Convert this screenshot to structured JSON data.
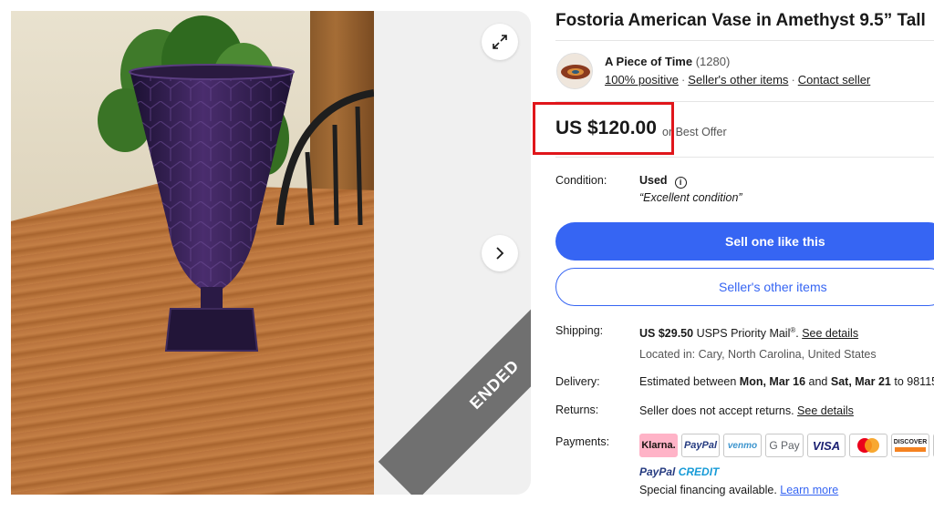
{
  "listing": {
    "title": "Fostoria American Vase in Amethyst 9.5” Tall",
    "ended_label": "ENDED"
  },
  "seller": {
    "name": "A Piece of Time",
    "feedback_count": "(1280)",
    "positive": "100% positive",
    "other_items": "Seller's other items",
    "contact": "Contact seller"
  },
  "price": {
    "amount": "US $120.00",
    "best_offer": "or Best Offer"
  },
  "condition": {
    "label": "Condition:",
    "value": "Used",
    "quote": "“Excellent condition”"
  },
  "buttons": {
    "sell_one": "Sell one like this",
    "other_items": "Seller's other items"
  },
  "shipping": {
    "label": "Shipping:",
    "price": "US $29.50",
    "service": "USPS Priority Mail",
    "registered": "®",
    "details_link": "See details",
    "location": "Located in: Cary, North Carolina, United States"
  },
  "delivery": {
    "label": "Delivery:",
    "prefix": "Estimated between",
    "start": "Mon, Mar 16",
    "and": "and",
    "end": "Sat, Mar 21",
    "to": "to 98115"
  },
  "returns": {
    "label": "Returns:",
    "text": "Seller does not accept returns.",
    "details_link": "See details"
  },
  "payments": {
    "label": "Payments:",
    "logos": [
      "Klarna.",
      "PayPal",
      "venmo",
      "G Pay",
      "VISA",
      "",
      "DISCOVER"
    ],
    "paypal_word": "PayPal",
    "credit_word": "CREDIT",
    "financing_text": "Special financing available.",
    "learn_more": "Learn more"
  },
  "icons": {
    "expand": "expand-icon",
    "next": "chevron-right-icon",
    "info": "info-icon"
  },
  "colors": {
    "primary_blue": "#3665f3",
    "highlight_red": "#e0161b",
    "ended_band": "#707070"
  }
}
